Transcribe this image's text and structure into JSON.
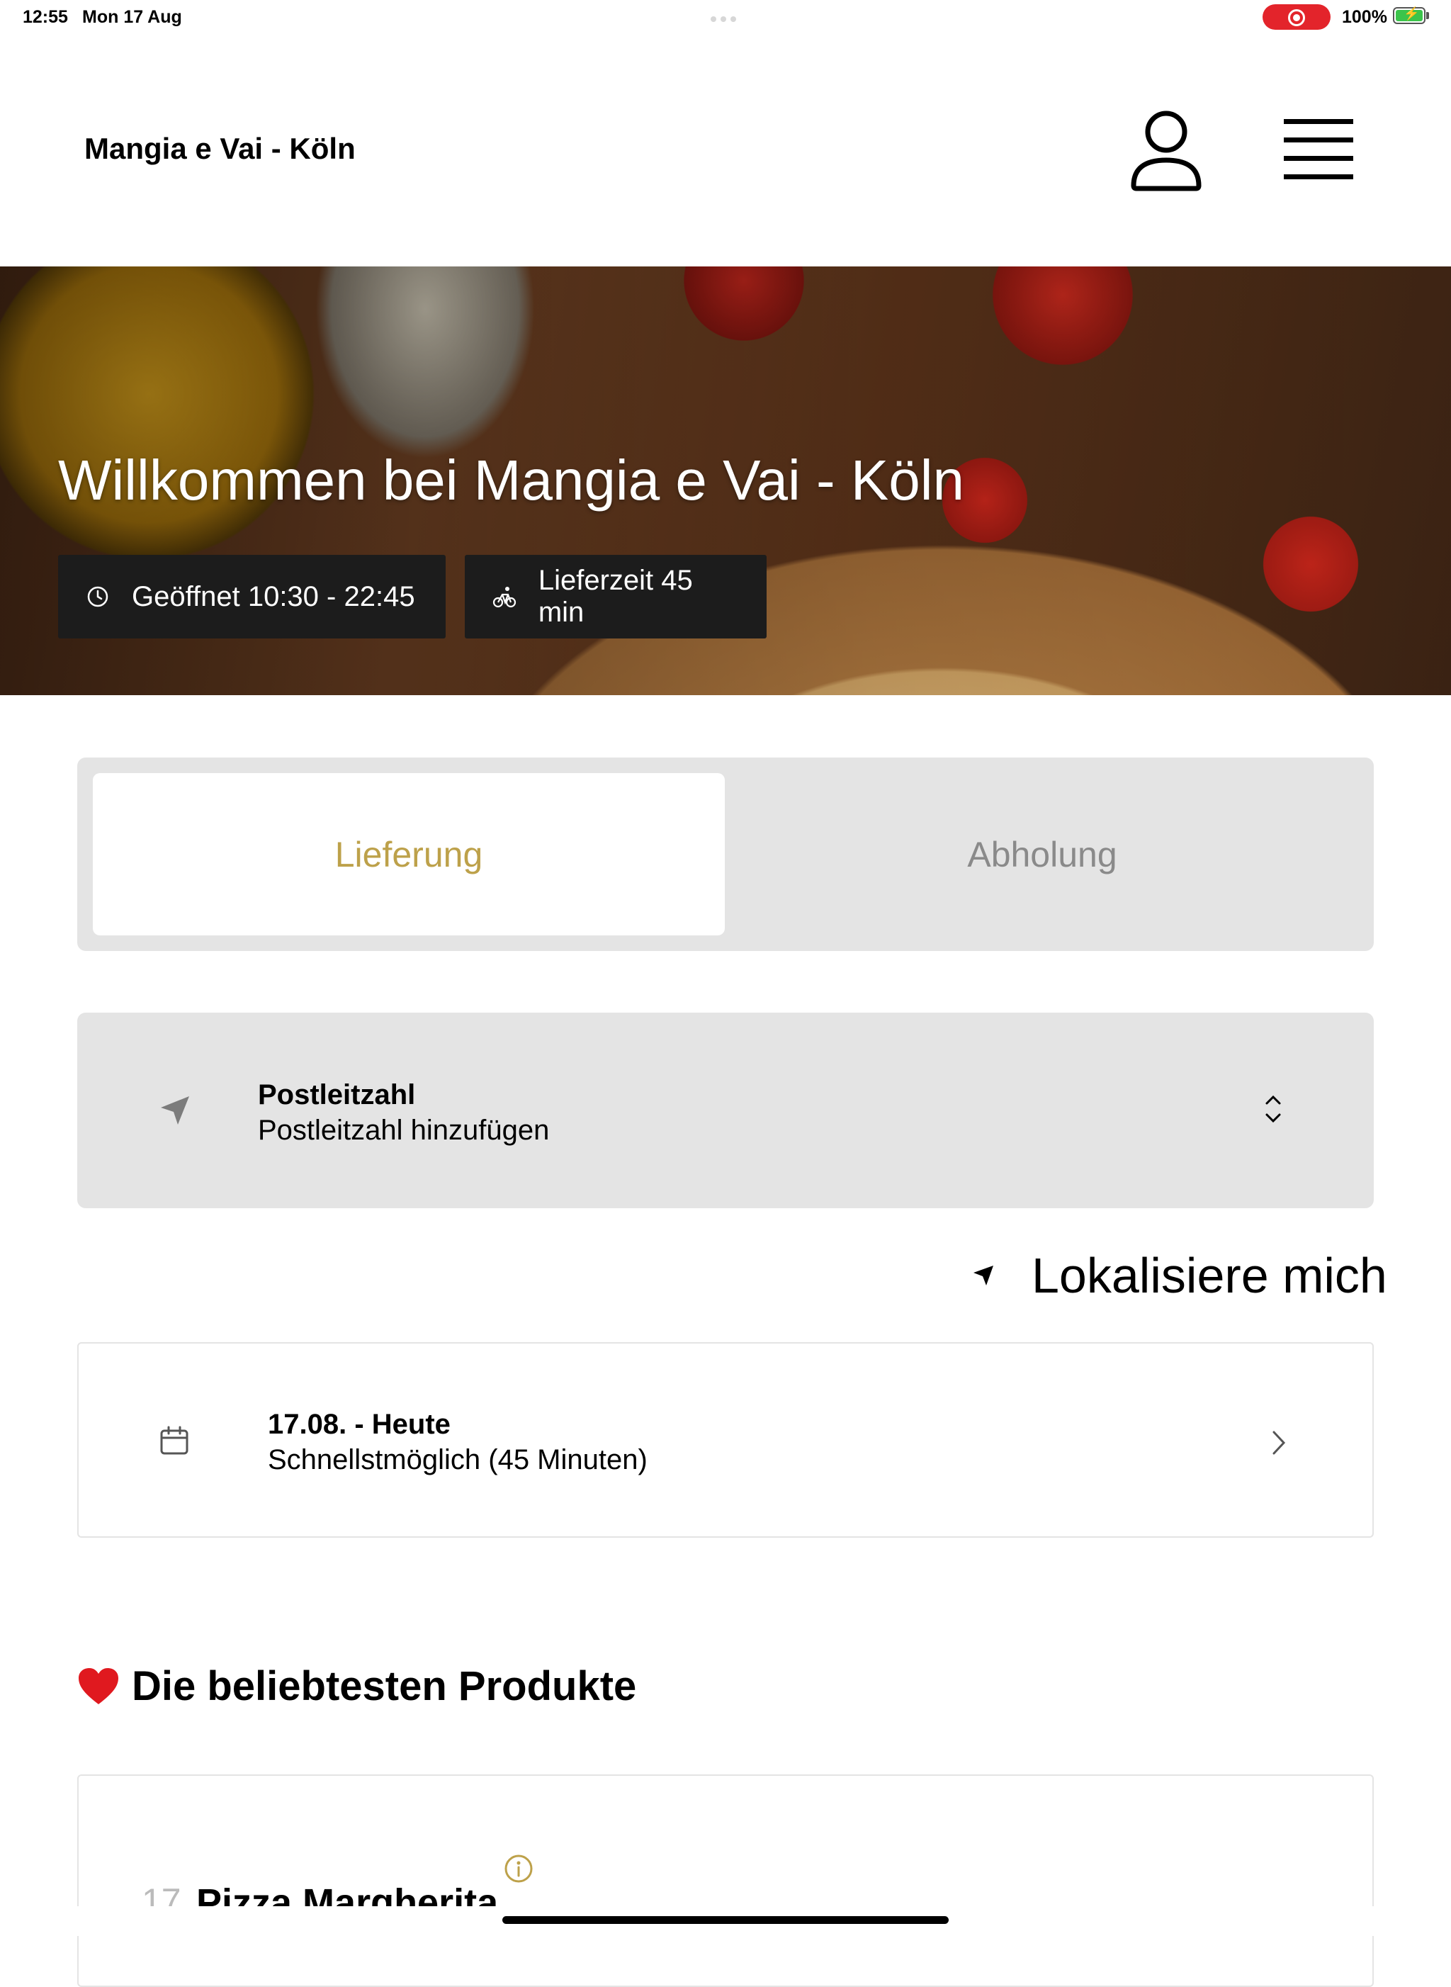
{
  "status_bar": {
    "time": "12:55",
    "date": "Mon 17 Aug",
    "battery": "100%",
    "record_color": "#e3242b",
    "battery_color": "#3bc44b"
  },
  "header": {
    "title": "Mangia e Vai - Köln",
    "profile_icon": "person-icon",
    "menu_icon": "hamburger-menu-icon"
  },
  "hero": {
    "title": "Willkommen bei Mangia e Vai - Köln",
    "opening_hours": "Geöffnet 10:30 - 22:45",
    "delivery_time": "Lieferzeit 45 min"
  },
  "order_mode": {
    "tabs": [
      {
        "label": "Lieferung",
        "active": true
      },
      {
        "label": "Abholung",
        "active": false
      }
    ],
    "accent_color": "#bda14a"
  },
  "postcode": {
    "label": "Postleitzahl",
    "value": "Postleitzahl hinzufügen"
  },
  "locate": {
    "label": "Lokalisiere mich"
  },
  "delivery_date": {
    "title": "17.08. - Heute",
    "subtitle": "Schnellstmöglich (45 Minuten)"
  },
  "popular": {
    "title": "Die beliebtesten Produkte",
    "products": [
      {
        "number": "17",
        "name": "Pizza Margherita"
      }
    ]
  }
}
